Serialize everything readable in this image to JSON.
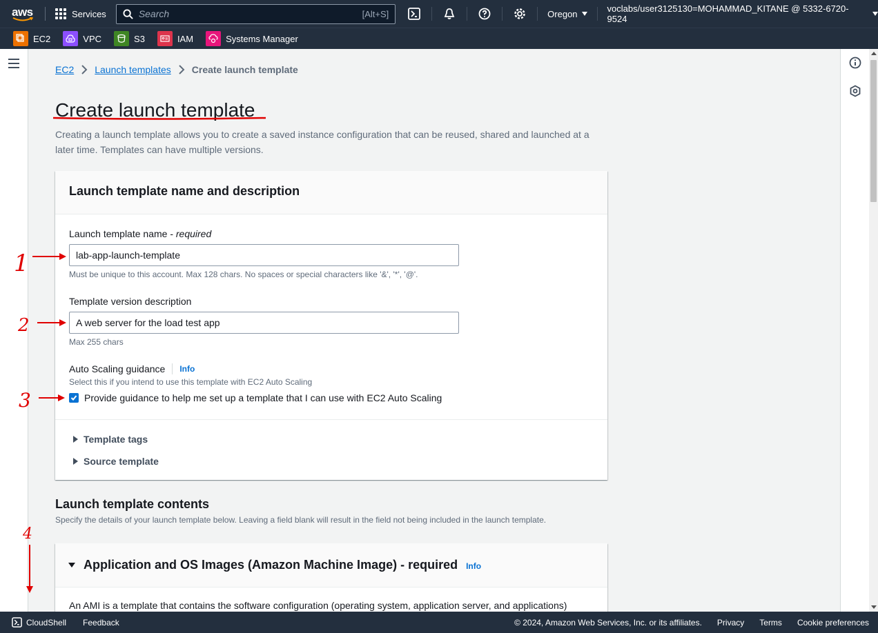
{
  "topnav": {
    "logo": "aws",
    "services_label": "Services",
    "search_placeholder": "Search",
    "search_shortcut": "[Alt+S]",
    "region": "Oregon",
    "account": "voclabs/user3125130=MOHAMMAD_KITANE @ 5332-6720-9524"
  },
  "favorites": [
    {
      "label": "EC2",
      "color": "#ed7100",
      "icon": "ec2-icon"
    },
    {
      "label": "VPC",
      "color": "#8c4fff",
      "icon": "vpc-icon"
    },
    {
      "label": "S3",
      "color": "#3f8624",
      "icon": "s3-icon"
    },
    {
      "label": "IAM",
      "color": "#dd344c",
      "icon": "iam-icon"
    },
    {
      "label": "Systems Manager",
      "color": "#e7157b",
      "icon": "systems-manager-icon"
    }
  ],
  "breadcrumb": {
    "items": [
      "EC2",
      "Launch templates"
    ],
    "current": "Create launch template"
  },
  "page": {
    "title": "Create launch template",
    "description": "Creating a launch template allows you to create a saved instance configuration that can be reused, shared and launched at a later time. Templates can have multiple versions."
  },
  "name_panel": {
    "header": "Launch template name and description",
    "name_label": "Launch template name - ",
    "name_label_required": "required",
    "name_value": "lab-app-launch-template",
    "name_constraint": "Must be unique to this account. Max 128 chars. No spaces or special characters like '&', '*', '@'.",
    "desc_label": "Template version description",
    "desc_value": "A web server for the load test app",
    "desc_constraint": "Max 255 chars",
    "asg_label": "Auto Scaling guidance",
    "info": "Info",
    "asg_hint": "Select this if you intend to use this template with EC2 Auto Scaling",
    "asg_checkbox_label": "Provide guidance to help me set up a template that I can use with EC2 Auto Scaling",
    "asg_checked": true,
    "expander_tags": "Template tags",
    "expander_source": "Source template"
  },
  "contents": {
    "title": "Launch template contents",
    "description": "Specify the details of your launch template below. Leaving a field blank will result in the field not being included in the launch template."
  },
  "ami_panel": {
    "header": "Application and OS Images (Amazon Machine Image) - required",
    "info": "Info",
    "description": "An AMI is a template that contains the software configuration (operating system, application server, and applications)"
  },
  "footer": {
    "cloudshell": "CloudShell",
    "feedback": "Feedback",
    "copyright": "© 2024, Amazon Web Services, Inc. or its affiliates.",
    "privacy": "Privacy",
    "terms": "Terms",
    "cookie": "Cookie preferences"
  },
  "annotations": {
    "labels": [
      "1",
      "2",
      "3",
      "4"
    ],
    "color": "#e00000"
  }
}
